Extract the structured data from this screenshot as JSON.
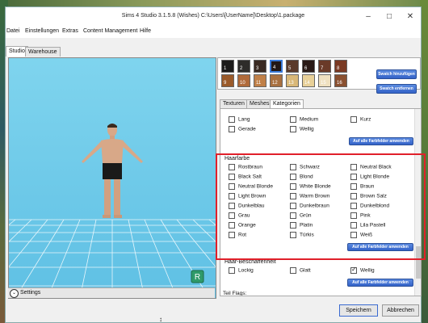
{
  "window": {
    "title": "Sims 4 Studio 3.1.5.8 (Wishes)  C:\\Users\\[UserName]\\Desktop\\1.package"
  },
  "menu": [
    "Datei",
    "Einstellungen",
    "Extras",
    "Content Management",
    "Hilfe"
  ],
  "main_tabs": [
    {
      "label": "Studio",
      "active": true
    },
    {
      "label": "Warehouse",
      "active": false
    }
  ],
  "viewport": {
    "settings_label": "Settings",
    "badge": "R"
  },
  "swatches": [
    {
      "num": "1",
      "color": "#1c1b1a"
    },
    {
      "num": "2",
      "color": "#2e2c2a"
    },
    {
      "num": "3",
      "color": "#3a2a22"
    },
    {
      "num": "4",
      "color": "#221816"
    },
    {
      "num": "5",
      "color": "#5a3a2a"
    },
    {
      "num": "6",
      "color": "#2a1a16"
    },
    {
      "num": "7",
      "color": "#6a3a28"
    },
    {
      "num": "8",
      "color": "#7a3a24"
    },
    {
      "num": "9",
      "color": "#9a5a2a"
    },
    {
      "num": "10",
      "color": "#b06a3a"
    },
    {
      "num": "11",
      "color": "#c08048"
    },
    {
      "num": "12",
      "color": "#a87040"
    },
    {
      "num": "13",
      "color": "#d9b878"
    },
    {
      "num": "14",
      "color": "#e8d098"
    },
    {
      "num": "15",
      "color": "#efe0c0"
    },
    {
      "num": "16",
      "color": "#8a5030"
    }
  ],
  "swatch_buttons": {
    "add": "Swatch hinzufügen",
    "remove": "Swatch entfernen"
  },
  "sub_tabs": [
    {
      "label": "Texturen",
      "active": false
    },
    {
      "label": "Meshes",
      "active": false
    },
    {
      "label": "Kategorien",
      "active": true
    }
  ],
  "length_section": {
    "options": [
      {
        "label": "Lang",
        "checked": false
      },
      {
        "label": "Medium",
        "checked": false
      },
      {
        "label": "Kurz",
        "checked": false
      },
      {
        "label": "Gerade",
        "checked": false
      },
      {
        "label": "Wellig",
        "checked": false
      }
    ],
    "apply_label": "Auf alle Farbfelder anwenden"
  },
  "haarfarbe": {
    "title": "Haarfarbe",
    "options": [
      "Rostbraun",
      "Schwarz",
      "Neutral Black",
      "Black Salt",
      "Blond",
      "Light Blonde",
      "Neutral Blonde",
      "White Blonde",
      "Braun",
      "Light Brown",
      "Warm Brown",
      "Brown Salz",
      "Dunkelblau",
      "Dunkelbraun",
      "Dunkelblond",
      "Grau",
      "Grün",
      "Pink",
      "Orange",
      "Platin",
      "Lila Pastell",
      "Rot",
      "Türkis",
      "Weiß"
    ],
    "apply_label": "Auf alle Farbfelder anwenden"
  },
  "beschaffenheit": {
    "title": "Haar-Beschaffenheit",
    "options": [
      {
        "label": "Lockig",
        "checked": false
      },
      {
        "label": "Glatt",
        "checked": false
      },
      {
        "label": "Wellig",
        "checked": true
      }
    ],
    "apply_label": "Auf alle Farbfelder anwenden"
  },
  "teil_flags": {
    "label": "Teil Flags:"
  },
  "footer": {
    "save": "Speichern",
    "cancel": "Abbrechen"
  },
  "colors": {
    "accent": "#3463c8",
    "highlight": "#e0202a",
    "viewport": "#7fd0e9"
  }
}
